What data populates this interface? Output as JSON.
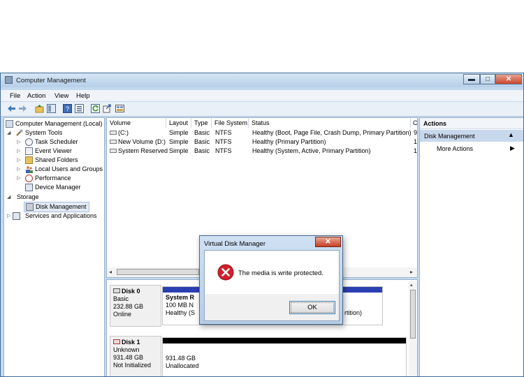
{
  "window": {
    "title": "Computer Management",
    "controls": {
      "minimize": "▬",
      "maximize": "□",
      "close": "✕"
    }
  },
  "menu": [
    "File",
    "Action",
    "View",
    "Help"
  ],
  "toolbar": [
    "back-icon",
    "forward-icon",
    "up-icon",
    "show-hide-tree-icon",
    "help-icon",
    "properties-icon",
    "refresh-icon",
    "export-icon",
    "console-icon"
  ],
  "tree": {
    "root": "Computer Management (Local)",
    "system_tools": "System Tools",
    "task_scheduler": "Task Scheduler",
    "event_viewer": "Event Viewer",
    "shared_folders": "Shared Folders",
    "local_users": "Local Users and Groups",
    "performance": "Performance",
    "device_manager": "Device Manager",
    "storage": "Storage",
    "disk_management": "Disk Management",
    "services": "Services and Applications"
  },
  "volumes": {
    "headers": {
      "volume": "Volume",
      "layout": "Layout",
      "type": "Type",
      "fs": "File System",
      "status": "Status",
      "cap": "C"
    },
    "rows": [
      {
        "volume": "(C:)",
        "layout": "Simple",
        "type": "Basic",
        "fs": "NTFS",
        "status": "Healthy (Boot, Page File, Crash Dump, Primary Partition)",
        "cap": "9("
      },
      {
        "volume": "New Volume (D:)",
        "layout": "Simple",
        "type": "Basic",
        "fs": "NTFS",
        "status": "Healthy (Primary Partition)",
        "cap": "1."
      },
      {
        "volume": "System Reserved",
        "layout": "Simple",
        "type": "Basic",
        "fs": "NTFS",
        "status": "Healthy (System, Active, Primary Partition)",
        "cap": "1("
      }
    ]
  },
  "disks": {
    "disk0": {
      "name": "Disk 0",
      "type": "Basic",
      "size": "232.88 GB",
      "state": "Online",
      "part1_name": "System R",
      "part1_size": "100 MB N",
      "part1_status": "Healthy (S",
      "part_right_status": "rtition)"
    },
    "disk1": {
      "name": "Disk 1",
      "type": "Unknown",
      "size": "931.48 GB",
      "state": "Not Initialized",
      "part_size": "931.48 GB",
      "part_status": "Unallocated"
    }
  },
  "actions": {
    "header": "Actions",
    "section": "Disk Management",
    "more": "More Actions"
  },
  "dialog": {
    "title": "Virtual Disk Manager",
    "close": "✕",
    "message": "The media is write protected.",
    "ok": "OK"
  },
  "colors": {
    "selection": "#c7dcf3",
    "partition_bar": "#2a3fb0",
    "error_red": "#d3202c"
  }
}
